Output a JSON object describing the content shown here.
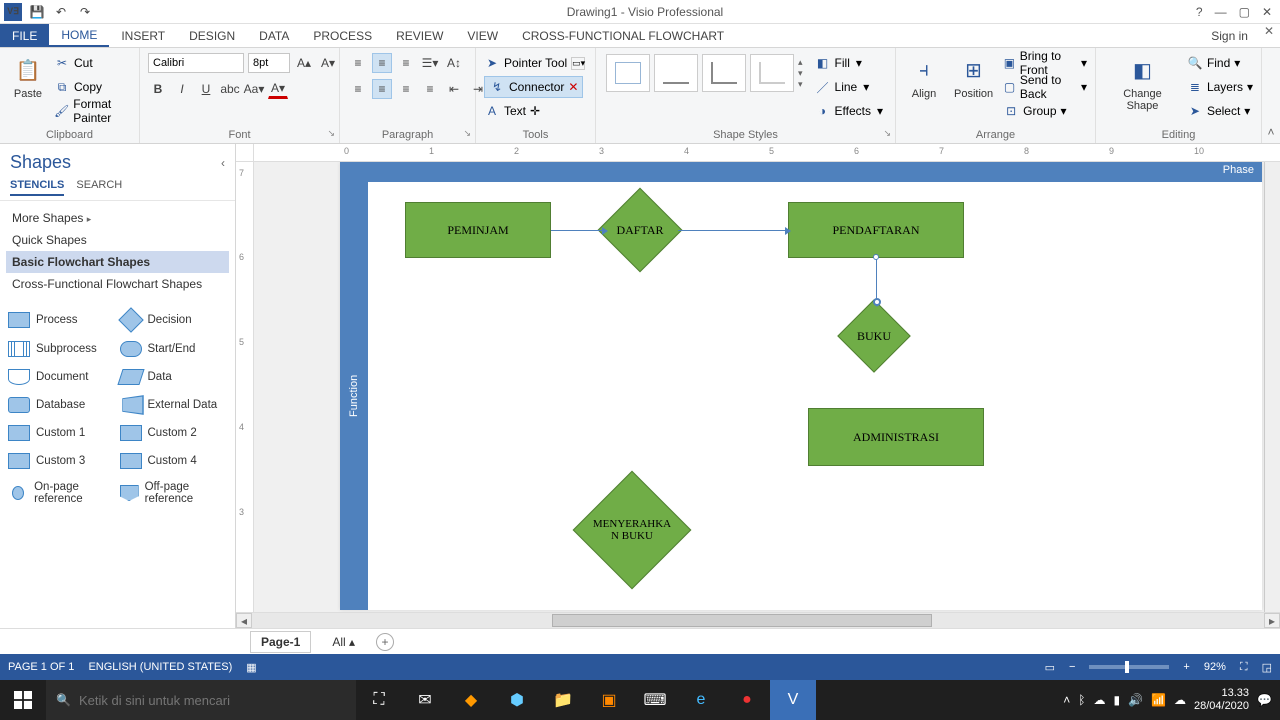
{
  "title": "Drawing1 - Visio Professional",
  "signin": "Sign in",
  "tabs": {
    "file": "FILE",
    "home": "HOME",
    "insert": "INSERT",
    "design": "DESIGN",
    "data": "DATA",
    "process": "PROCESS",
    "review": "REVIEW",
    "view": "VIEW",
    "cff": "CROSS-FUNCTIONAL FLOWCHART"
  },
  "ribbon": {
    "clipboard": {
      "paste": "Paste",
      "cut": "Cut",
      "copy": "Copy",
      "format_painter": "Format Painter",
      "label": "Clipboard"
    },
    "font": {
      "family": "Calibri",
      "size": "8pt",
      "label": "Font"
    },
    "paragraph": {
      "label": "Paragraph"
    },
    "tools": {
      "pointer": "Pointer Tool",
      "connector": "Connector",
      "text": "Text",
      "label": "Tools"
    },
    "shape_styles": {
      "fill": "Fill",
      "line": "Line",
      "effects": "Effects",
      "label": "Shape Styles"
    },
    "arrange": {
      "align": "Align",
      "position": "Position",
      "btf": "Bring to Front",
      "stb": "Send to Back",
      "group": "Group",
      "label": "Arrange"
    },
    "editing": {
      "change_shape": "Change Shape",
      "find": "Find",
      "layers": "Layers",
      "select": "Select",
      "label": "Editing"
    }
  },
  "shapes_panel": {
    "title": "Shapes",
    "subtabs": {
      "stencils": "STENCILS",
      "search": "SEARCH"
    },
    "stencils": [
      "More Shapes",
      "Quick Shapes",
      "Basic Flowchart Shapes",
      "Cross-Functional Flowchart Shapes"
    ],
    "shapes": [
      {
        "n": "Process",
        "c": "process"
      },
      {
        "n": "Decision",
        "c": "decision"
      },
      {
        "n": "Subprocess",
        "c": "subproc"
      },
      {
        "n": "Start/End",
        "c": "startend"
      },
      {
        "n": "Document",
        "c": "document"
      },
      {
        "n": "Data",
        "c": "data"
      },
      {
        "n": "Database",
        "c": "db"
      },
      {
        "n": "External Data",
        "c": "ext"
      },
      {
        "n": "Custom 1",
        "c": "c1"
      },
      {
        "n": "Custom 2",
        "c": "c2"
      },
      {
        "n": "Custom 3",
        "c": "c3"
      },
      {
        "n": "Custom 4",
        "c": "c4"
      },
      {
        "n": "On-page reference",
        "c": "onpage"
      },
      {
        "n": "Off-page reference",
        "c": "offpage"
      }
    ]
  },
  "canvas": {
    "phase": "Phase",
    "function": "Function",
    "shapes": {
      "peminjam": "PEMINJAM",
      "daftar": "DAFTAR",
      "pendaftaran": "PENDAFTARAN",
      "buku": "BUKU",
      "administrasi": "ADMINISTRASI",
      "menyerahkan": "MENYERAHKA\nN BUKU"
    }
  },
  "pagetabs": {
    "page1": "Page-1",
    "all": "All"
  },
  "status": {
    "page": "PAGE 1 OF 1",
    "lang": "ENGLISH (UNITED STATES)",
    "zoom": "92%"
  },
  "taskbar": {
    "search_placeholder": "Ketik di sini untuk mencari",
    "time": "13.33",
    "date": "28/04/2020"
  }
}
